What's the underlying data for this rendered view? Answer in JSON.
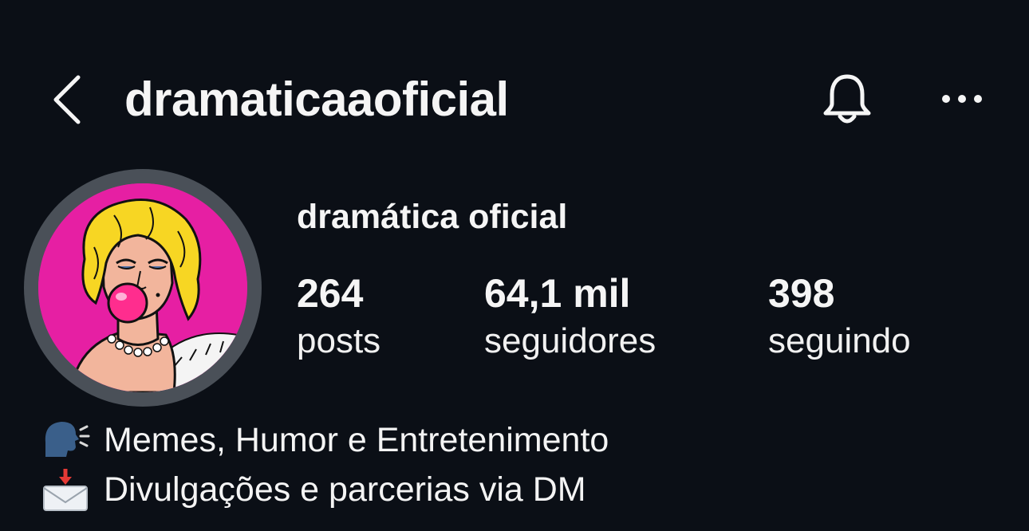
{
  "header": {
    "username": "dramaticaaoficial",
    "back_icon": "chevron-left-icon",
    "bell_icon": "bell-icon",
    "more_icon": "more-horizontal-icon"
  },
  "profile": {
    "display_name": "dramática oficial",
    "avatar": "pop-art-woman-bubblegum-avatar",
    "stats": {
      "posts": {
        "value": "264",
        "label": "posts"
      },
      "followers": {
        "value": "64,1 mil",
        "label": "seguidores"
      },
      "following": {
        "value": "398",
        "label": "seguindo"
      }
    }
  },
  "bio": {
    "lines": [
      {
        "icon": "speaking-head-icon",
        "text": "Memes, Humor e Entretenimento"
      },
      {
        "icon": "envelope-with-arrow-icon",
        "text": "Divulgações e parcerias via DM"
      }
    ]
  },
  "colors": {
    "background": "#0b0f16",
    "text": "#f5f5f5",
    "avatar_bg": "#e61fa3",
    "avatar_ring": "#4a5058"
  }
}
